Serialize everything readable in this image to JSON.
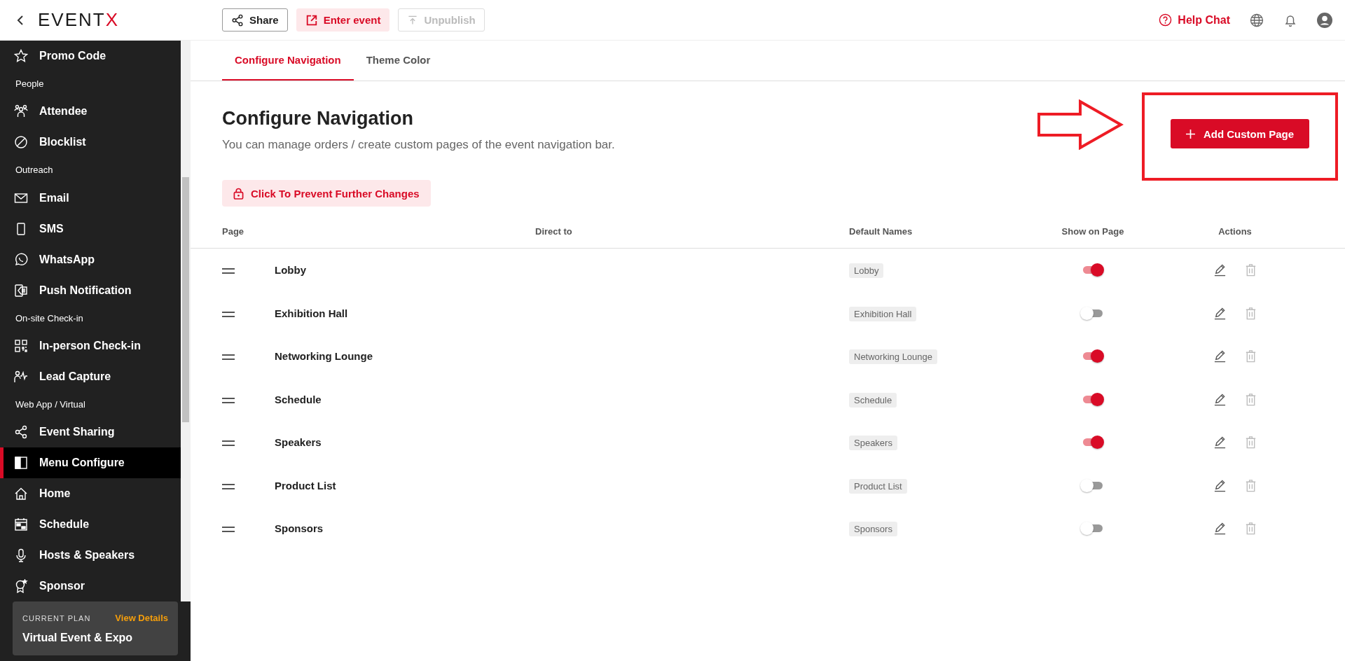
{
  "topbar": {
    "logo": {
      "main": "EVENT",
      "accent": "X"
    },
    "buttons": [
      {
        "label": "Share",
        "kind": "outline",
        "disabled": false
      },
      {
        "label": "Enter event",
        "kind": "tint",
        "disabled": false
      },
      {
        "label": "Unpublish",
        "kind": "outline",
        "disabled": true
      }
    ],
    "help": "Help Chat"
  },
  "sidebar": {
    "items": [
      {
        "kind": "item",
        "label": "Promo Code",
        "selected": false
      },
      {
        "kind": "section",
        "label": "People"
      },
      {
        "kind": "item",
        "label": "Attendee",
        "selected": false
      },
      {
        "kind": "item",
        "label": "Blocklist",
        "selected": false
      },
      {
        "kind": "section",
        "label": "Outreach"
      },
      {
        "kind": "item",
        "label": "Email",
        "selected": false
      },
      {
        "kind": "item",
        "label": "SMS",
        "selected": false
      },
      {
        "kind": "item",
        "label": "WhatsApp",
        "selected": false
      },
      {
        "kind": "item",
        "label": "Push Notification",
        "selected": false
      },
      {
        "kind": "section",
        "label": "On-site Check-in"
      },
      {
        "kind": "item",
        "label": "In-person Check-in",
        "selected": false
      },
      {
        "kind": "item",
        "label": "Lead Capture",
        "selected": false
      },
      {
        "kind": "section",
        "label": "Web App / Virtual"
      },
      {
        "kind": "item",
        "label": "Event Sharing",
        "selected": false
      },
      {
        "kind": "item",
        "label": "Menu Configure",
        "selected": true
      },
      {
        "kind": "item",
        "label": "Home",
        "selected": false
      },
      {
        "kind": "item",
        "label": "Schedule",
        "selected": false
      },
      {
        "kind": "item",
        "label": "Hosts & Speakers",
        "selected": false
      },
      {
        "kind": "item",
        "label": "Sponsor",
        "selected": false
      }
    ],
    "plan": {
      "label": "CURRENT PLAN",
      "link": "View Details",
      "name": "Virtual Event & Expo"
    }
  },
  "tabs": [
    {
      "label": "Configure Navigation",
      "selected": true
    },
    {
      "label": "Theme Color",
      "selected": false
    }
  ],
  "heading": "Configure Navigation",
  "subtitle": "You can manage orders / create custom pages of the event navigation bar.",
  "lock_button": "Click To Prevent Further Changes",
  "add_button": "Add Custom Page",
  "table": {
    "columns": [
      "Page",
      "Direct to",
      "Default Names",
      "Show on Page",
      "Actions"
    ],
    "rows": [
      {
        "page": "Lobby",
        "default_name": "Lobby",
        "on": true
      },
      {
        "page": "Exhibition Hall",
        "default_name": "Exhibition Hall",
        "on": false
      },
      {
        "page": "Networking Lounge",
        "default_name": "Networking Lounge",
        "on": true
      },
      {
        "page": "Schedule",
        "default_name": "Schedule",
        "on": true
      },
      {
        "page": "Speakers",
        "default_name": "Speakers",
        "on": true
      },
      {
        "page": "Product List",
        "default_name": "Product List",
        "on": false
      },
      {
        "page": "Sponsors",
        "default_name": "Sponsors",
        "on": false
      }
    ]
  }
}
